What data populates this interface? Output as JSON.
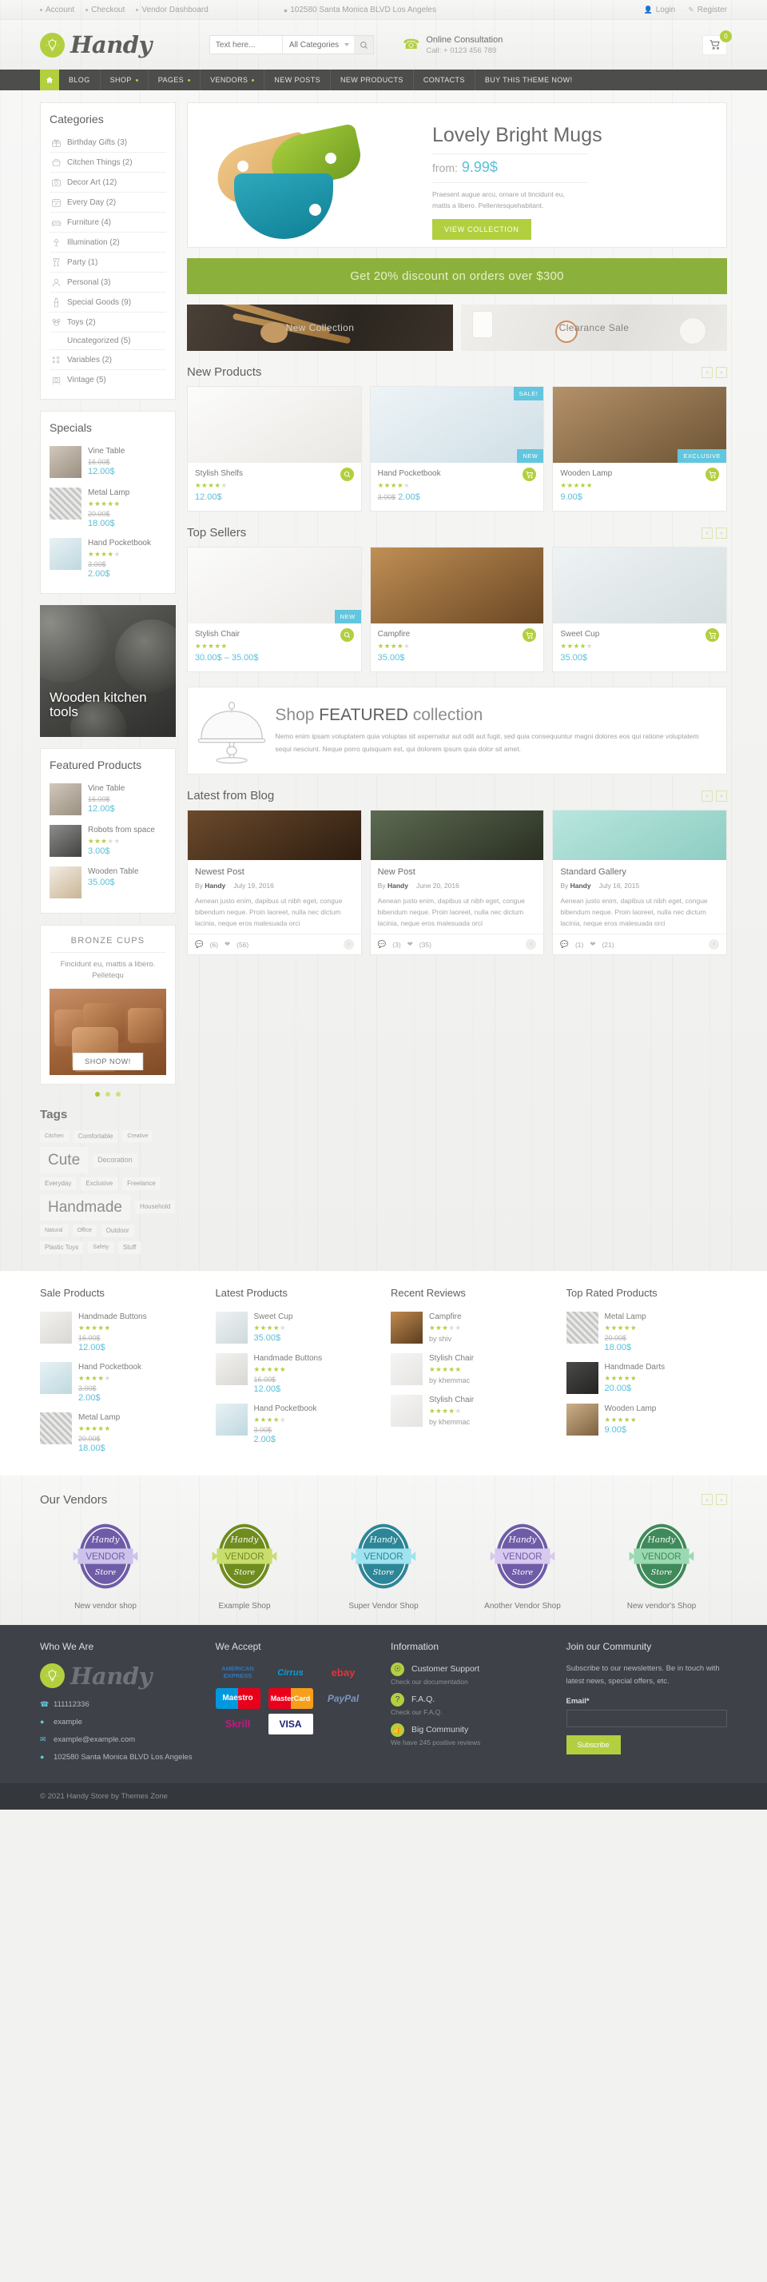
{
  "topbar": {
    "links": [
      "Account",
      "Checkout",
      "Vendor Dashboard"
    ],
    "address": "102580 Santa Monica BLVD Los Angeles",
    "login": "Login",
    "register": "Register"
  },
  "header": {
    "logo_text": "Handy",
    "search_placeholder": "Text here...",
    "search_category": "All Categories",
    "consult_title": "Online Consultation",
    "consult_phone": "Call: + 0123 456 789",
    "cart_count": "0"
  },
  "nav": {
    "items": [
      {
        "label": "BLOG",
        "has_caret": false
      },
      {
        "label": "SHOP",
        "has_caret": true
      },
      {
        "label": "PAGES",
        "has_caret": true
      },
      {
        "label": "VENDORS",
        "has_caret": true
      },
      {
        "label": "NEW POSTS",
        "has_caret": false
      },
      {
        "label": "NEW PRODUCTS",
        "has_caret": false
      },
      {
        "label": "CONTACTS",
        "has_caret": false
      },
      {
        "label": "BUY THIS THEME NOW!",
        "has_caret": false
      }
    ]
  },
  "sidebar": {
    "categories_title": "Categories",
    "categories": [
      {
        "label": "Birthday Gifts (3)",
        "icon": "gift-icon"
      },
      {
        "label": "Citchen Things (2)",
        "icon": "pot-icon"
      },
      {
        "label": "Decor Art (12)",
        "icon": "camera-icon"
      },
      {
        "label": "Every Day (2)",
        "icon": "calendar-icon"
      },
      {
        "label": "Furniture (4)",
        "icon": "sofa-icon"
      },
      {
        "label": "Illumination (2)",
        "icon": "lamp-icon"
      },
      {
        "label": "Party (1)",
        "icon": "glasses-icon"
      },
      {
        "label": "Personal (3)",
        "icon": "person-icon"
      },
      {
        "label": "Special Goods (9)",
        "icon": "bottle-icon"
      },
      {
        "label": "Toys (2)",
        "icon": "bear-icon"
      },
      {
        "label": "Uncategorized (5)",
        "icon": "none"
      },
      {
        "label": "Variables (2)",
        "icon": "options-icon"
      },
      {
        "label": "Vintage (5)",
        "icon": "vintage-icon"
      }
    ],
    "specials_title": "Specials",
    "specials": [
      {
        "name": "Vine Table",
        "old": "16.00$",
        "price": "12.00$",
        "stars": 0
      },
      {
        "name": "Metal Lamp",
        "old": "20.00$",
        "price": "18.00$",
        "stars": 5
      },
      {
        "name": "Hand Pocketbook",
        "old": "3.00$",
        "price": "2.00$",
        "stars": 4
      }
    ],
    "promo_tall_text": "Wooden kitchen tools",
    "featured_title": "Featured Products",
    "featured": [
      {
        "name": "Vine Table",
        "old": "16.00$",
        "price": "12.00$",
        "stars": 0
      },
      {
        "name": "Robots from space",
        "old": "",
        "price": "3.00$",
        "stars": 3
      },
      {
        "name": "Wooden Table",
        "old": "",
        "price": "35.00$",
        "stars": 0
      }
    ],
    "bronze": {
      "title": "BRONZE CUPS",
      "text": "Fincidunt eu, mattis a libero. Pelletequ",
      "button": "SHOP NOW!"
    },
    "tags_title": "Tags",
    "tags": [
      {
        "label": "Citchen",
        "size": "t-xs"
      },
      {
        "label": "Comfortable",
        "size": "t-sm"
      },
      {
        "label": "Creative",
        "size": "t-xs"
      },
      {
        "label": "Cute",
        "size": "t-xl"
      },
      {
        "label": "Decoration",
        "size": "t-md"
      },
      {
        "label": "Everyday",
        "size": "t-sm"
      },
      {
        "label": "Exclusive",
        "size": "t-sm"
      },
      {
        "label": "Freelance",
        "size": "t-sm"
      },
      {
        "label": "Handmade",
        "size": "t-xl"
      },
      {
        "label": "Household",
        "size": "t-sm"
      },
      {
        "label": "Natural",
        "size": "t-xs"
      },
      {
        "label": "Office",
        "size": "t-xs"
      },
      {
        "label": "Outdoor",
        "size": "t-sm"
      },
      {
        "label": "Plastic Toys",
        "size": "t-sm"
      },
      {
        "label": "Safety",
        "size": "t-xs"
      },
      {
        "label": "Stuff",
        "size": "t-sm"
      }
    ]
  },
  "hero": {
    "title": "Lovely Bright Mugs",
    "from_label": "from:",
    "price": "9.99$",
    "desc": "Praesent augue arcu, ornare ut tincidunt eu, mattis a libero. Pellentesquehabitant.",
    "button": "VIEW COLLECTION"
  },
  "discount_banner": "Get 20% discount on orders over $300",
  "promos": [
    {
      "label": "New Collection"
    },
    {
      "label": "Clearance Sale"
    }
  ],
  "new_products": {
    "title": "New Products",
    "items": [
      {
        "name": "Stylish Shelfs",
        "stars": 4,
        "old": "",
        "price": "12.00$",
        "badge": "",
        "badge_pos": "",
        "action": "search-icon"
      },
      {
        "name": "Hand Pocketbook",
        "stars": 4,
        "old": "3.00$",
        "price": "2.00$",
        "badge": "SALE!",
        "badge2": "NEW",
        "badge_pos": "tr",
        "action": "cart-icon"
      },
      {
        "name": "Wooden Lamp",
        "stars": 5,
        "old": "",
        "price": "9.00$",
        "badge": "EXCLUSIVE",
        "badge_pos": "br",
        "action": "cart-icon"
      }
    ]
  },
  "top_sellers": {
    "title": "Top Sellers",
    "items": [
      {
        "name": "Stylish Chair",
        "stars": 4.5,
        "price": "30.00$ – 35.00$",
        "badge": "NEW",
        "badge_pos": "br",
        "action": "search-icon"
      },
      {
        "name": "Campfire",
        "stars": 4,
        "price": "35.00$",
        "badge": "",
        "badge_pos": "",
        "action": "cart-icon"
      },
      {
        "name": "Sweet Cup",
        "stars": 4,
        "price": "35.00$",
        "badge": "",
        "badge_pos": "",
        "action": "cart-icon"
      }
    ]
  },
  "featured_collection": {
    "title_1": "Shop ",
    "title_bold": "FEATURED",
    "title_2": " collection",
    "desc": "Nemo enim ipsam voluptatem quia voluptas sit aspernatur aut odit aut fugit, sed quia consequuntur magni dolores eos qui ratione voluptatem sequi nesciunt. Neque porro quisquam est, qui dolorem ipsum quia dolor sit amet."
  },
  "blog": {
    "title": "Latest from Blog",
    "posts": [
      {
        "title": "Newest Post",
        "by": "By",
        "author": "Handy",
        "date": "July 19, 2016",
        "excerpt": "Aenean justo enim, dapibus ut nibh eget, congue bibendum neque. Proin laoreet, nulla nec dictum lacinia, neque eros malesuada orci",
        "comments": "(6)",
        "likes": "(56)"
      },
      {
        "title": "New Post",
        "by": "By",
        "author": "Handy",
        "date": "June 20, 2016",
        "excerpt": "Aenean justo enim, dapibus ut nibh eget, congue bibendum neque. Proin laoreet, nulla nec dictum lacinia, neque eros malesuada orci",
        "comments": "(3)",
        "likes": "(35)"
      },
      {
        "title": "Standard Gallery",
        "by": "By",
        "author": "Handy",
        "date": "July 16, 2015",
        "excerpt": "Aenean justo enim, dapibus ut nibh eget, congue bibendum neque. Proin laoreet, nulla nec dictum lacinia, neque eros malesuada orci",
        "comments": "(1)",
        "likes": "(21)"
      }
    ]
  },
  "bottom_columns": [
    {
      "title": "Sale Products",
      "items": [
        {
          "name": "Handmade Buttons",
          "stars": 4.5,
          "old": "16.00$",
          "price": "12.00$"
        },
        {
          "name": "Hand Pocketbook",
          "stars": 4,
          "old": "3.00$",
          "price": "2.00$"
        },
        {
          "name": "Metal Lamp",
          "stars": 5,
          "old": "20.00$",
          "price": "18.00$"
        }
      ]
    },
    {
      "title": "Latest Products",
      "items": [
        {
          "name": "Sweet Cup",
          "stars": 4,
          "old": "",
          "price": "35.00$"
        },
        {
          "name": "Handmade Buttons",
          "stars": 4.5,
          "old": "16.00$",
          "price": "12.00$"
        },
        {
          "name": "Hand Pocketbook",
          "stars": 4,
          "old": "3.00$",
          "price": "2.00$"
        }
      ]
    },
    {
      "title": "Recent Reviews",
      "items": [
        {
          "name": "Campfire",
          "stars": 3,
          "old": "",
          "price": "",
          "by": "by shiv"
        },
        {
          "name": "Stylish Chair",
          "stars": 5,
          "old": "",
          "price": "",
          "by": "by khemmac"
        },
        {
          "name": "Stylish Chair",
          "stars": 4,
          "old": "",
          "price": "",
          "by": "by khemmac"
        }
      ]
    },
    {
      "title": "Top Rated Products",
      "items": [
        {
          "name": "Metal Lamp",
          "stars": 5,
          "old": "20.00$",
          "price": "18.00$"
        },
        {
          "name": "Handmade Darts",
          "stars": 5,
          "old": "",
          "price": "20.00$"
        },
        {
          "name": "Wooden Lamp",
          "stars": 5,
          "old": "",
          "price": "9.00$"
        }
      ]
    }
  ],
  "vendors": {
    "title": "Our Vendors",
    "badge_top": "Handy",
    "badge_mid": "VENDOR",
    "badge_bot": "Store",
    "items": [
      {
        "name": "New vendor shop",
        "color": "#6f5ca8",
        "ribbon": "#cdc2ea"
      },
      {
        "name": "Example Shop",
        "color": "#6f8c1e",
        "ribbon": "#c9dd6f"
      },
      {
        "name": "Super Vendor Shop",
        "color": "#2d8697",
        "ribbon": "#9fe3f0"
      },
      {
        "name": "Another Vendor Shop",
        "color": "#6f5ca8",
        "ribbon": "#d7c9ef"
      },
      {
        "name": "New vendor's Shop",
        "color": "#3f8a5a",
        "ribbon": "#9ad9b1"
      }
    ]
  },
  "footer": {
    "col1_title": "Who We Are",
    "logo_text": "Handy",
    "phone": "111112336",
    "skype": "example",
    "email": "example@example.com",
    "address": "102580 Santa Monica BLVD Los Angeles",
    "col2_title": "We Accept",
    "payments": [
      "AMERICAN EXPRESS",
      "Cirrus",
      "ebay",
      "Maestro",
      "MasterCard",
      "PayPal",
      "Skrill",
      "VISA"
    ],
    "col3_title": "Information",
    "info": [
      {
        "label": "Customer Support",
        "sub": "Check our documentation",
        "icon": "lifebuoy-icon"
      },
      {
        "label": "F.A.Q.",
        "sub": "Check our F.A.Q.",
        "icon": "question-icon"
      },
      {
        "label": "Big Community",
        "sub": "We have 245 positive reviews",
        "icon": "thumbsup-icon"
      }
    ],
    "col4_title": "Join our Community",
    "newsletter": "Subscribe to our newsletters. Be in touch with latest news, special offers, etc.",
    "email_label": "Email*",
    "email_value": "",
    "subscribe": "Subscribe",
    "copyright": "© 2021  Handy Store by Themes Zone"
  }
}
